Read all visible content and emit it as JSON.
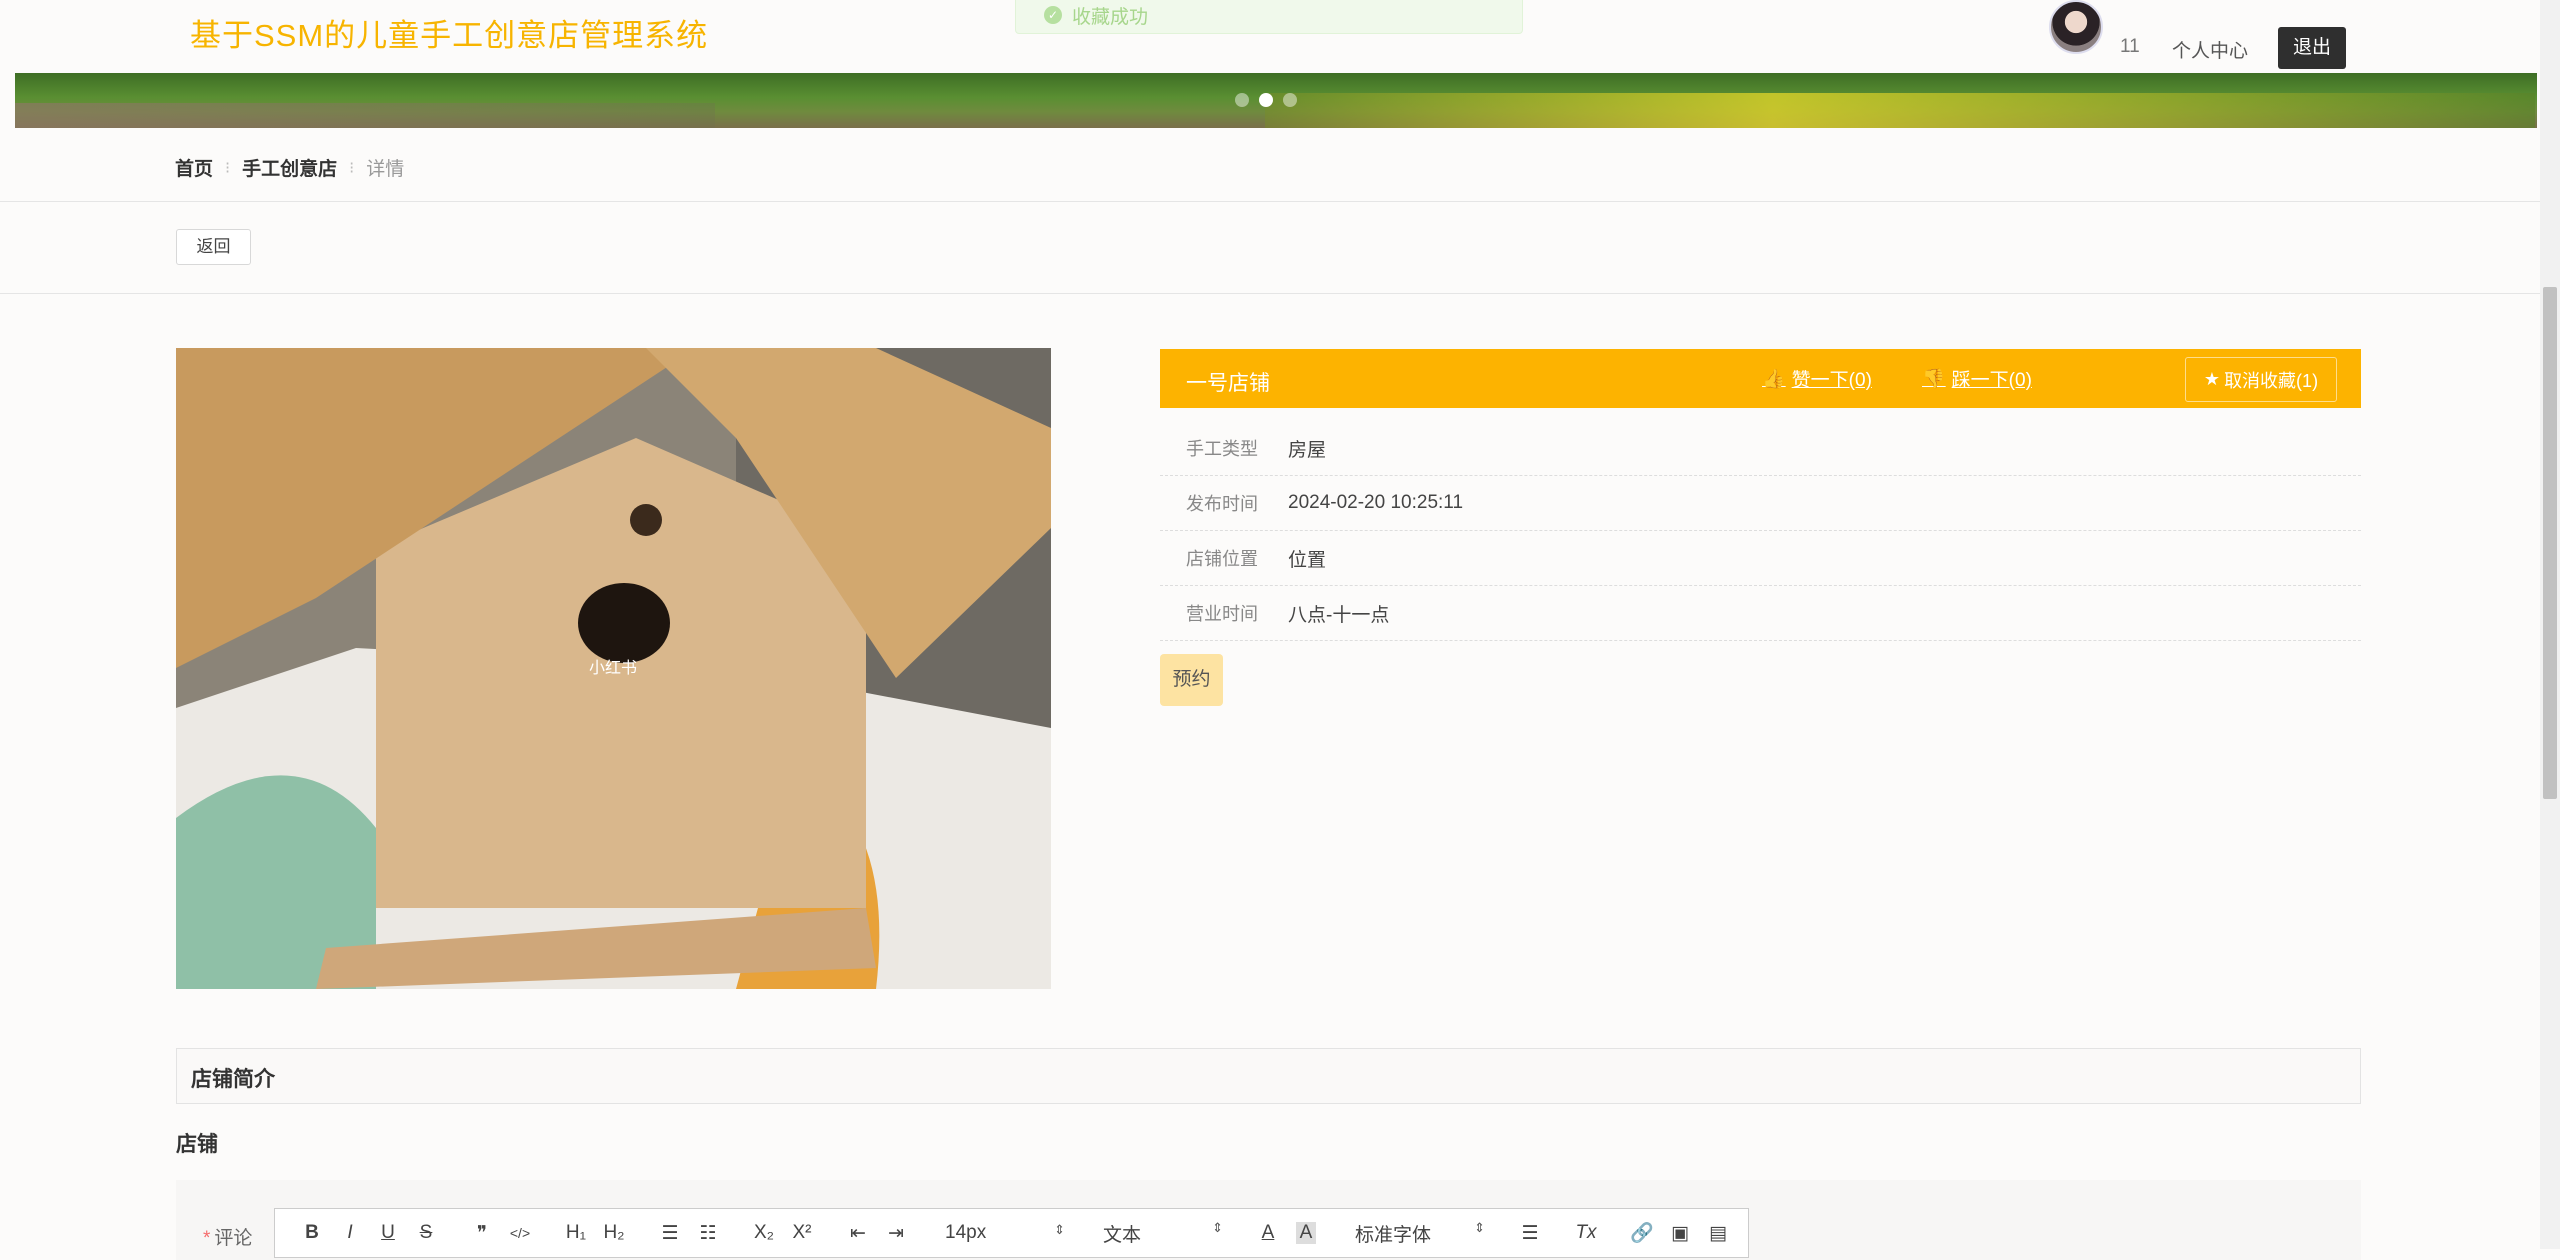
{
  "header": {
    "site_title": "基于SSM的儿童手工创意店管理系统",
    "toast": "收藏成功",
    "user_num": "11",
    "user_center": "个人中心",
    "logout": "退出"
  },
  "carousel": {
    "slides": 3,
    "active": 2
  },
  "breadcrumb": {
    "home": "首页",
    "section": "手工创意店",
    "current": "详情"
  },
  "back_label": "返回",
  "photo": {
    "watermark": "小红书"
  },
  "shop": {
    "name": "一号店铺",
    "like": "赞一下(0)",
    "dislike": "踩一下(0)",
    "favorite": "取消收藏(1)",
    "fields": [
      {
        "label": "手工类型",
        "value": "房屋"
      },
      {
        "label": "发布时间",
        "value": "2024-02-20 10:25:11"
      },
      {
        "label": "店铺位置",
        "value": "位置"
      },
      {
        "label": "营业时间",
        "value": "八点-十一点"
      }
    ],
    "book": "预约"
  },
  "intro": {
    "title": "店铺简介",
    "body": "店铺"
  },
  "comment": {
    "label": "评论",
    "required_mark": "*",
    "toolbar": {
      "bold": "B",
      "italic": "I",
      "underline": "U",
      "strike": "S",
      "quote": "❞",
      "code": "</>",
      "h1": "H₁",
      "h2": "H₂",
      "ol": "☰",
      "ul": "☷",
      "sub": "X₂",
      "sup": "X²",
      "outdent": "⇤",
      "indent": "⇥",
      "size": "14px",
      "header": "文本",
      "color": "A",
      "bg": "A",
      "font": "标准字体",
      "align": "☰",
      "clean": "Tx",
      "link": "🔗",
      "image": "▣",
      "video": "▤"
    }
  },
  "colors": {
    "accent": "#fdb300",
    "title": "#f7b400",
    "book_bg": "#fde3a2"
  }
}
